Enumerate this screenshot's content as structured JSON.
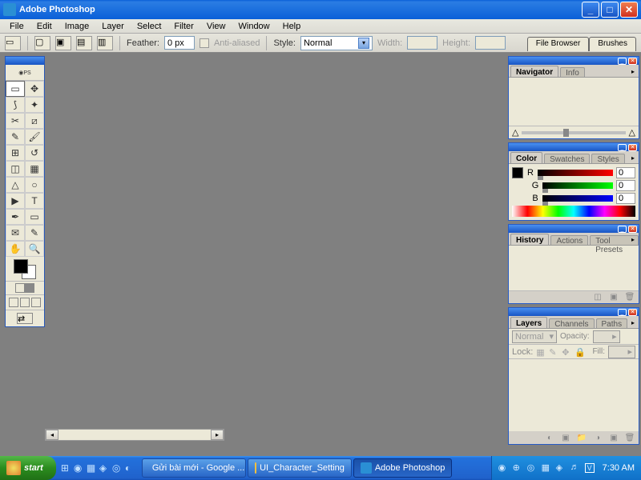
{
  "title": "Adobe Photoshop",
  "menu": [
    "File",
    "Edit",
    "Image",
    "Layer",
    "Select",
    "Filter",
    "View",
    "Window",
    "Help"
  ],
  "options": {
    "feather_label": "Feather:",
    "feather_value": "0 px",
    "antialias_label": "Anti-aliased",
    "style_label": "Style:",
    "style_value": "Normal",
    "width_label": "Width:",
    "height_label": "Height:"
  },
  "dock_tabs": [
    "File Browser",
    "Brushes"
  ],
  "panels": {
    "navigator": {
      "tabs": [
        "Navigator",
        "Info"
      ],
      "active": 0
    },
    "color": {
      "tabs": [
        "Color",
        "Swatches",
        "Styles"
      ],
      "active": 0,
      "channels": [
        {
          "label": "R",
          "value": "0"
        },
        {
          "label": "G",
          "value": "0"
        },
        {
          "label": "B",
          "value": "0"
        }
      ]
    },
    "history": {
      "tabs": [
        "History",
        "Actions",
        "Tool Presets"
      ],
      "active": 0
    },
    "layers": {
      "tabs": [
        "Layers",
        "Channels",
        "Paths"
      ],
      "active": 0,
      "blend": "Normal",
      "opacity_label": "Opacity:",
      "lock_label": "Lock:",
      "fill_label": "Fill:"
    }
  },
  "taskbar": {
    "start": "start",
    "tasks": [
      {
        "label": "Gửi bài mới - Google ...",
        "active": false
      },
      {
        "label": "UI_Character_Setting",
        "active": false
      },
      {
        "label": "Adobe Photoshop",
        "active": true
      }
    ],
    "clock": "7:30 AM"
  }
}
